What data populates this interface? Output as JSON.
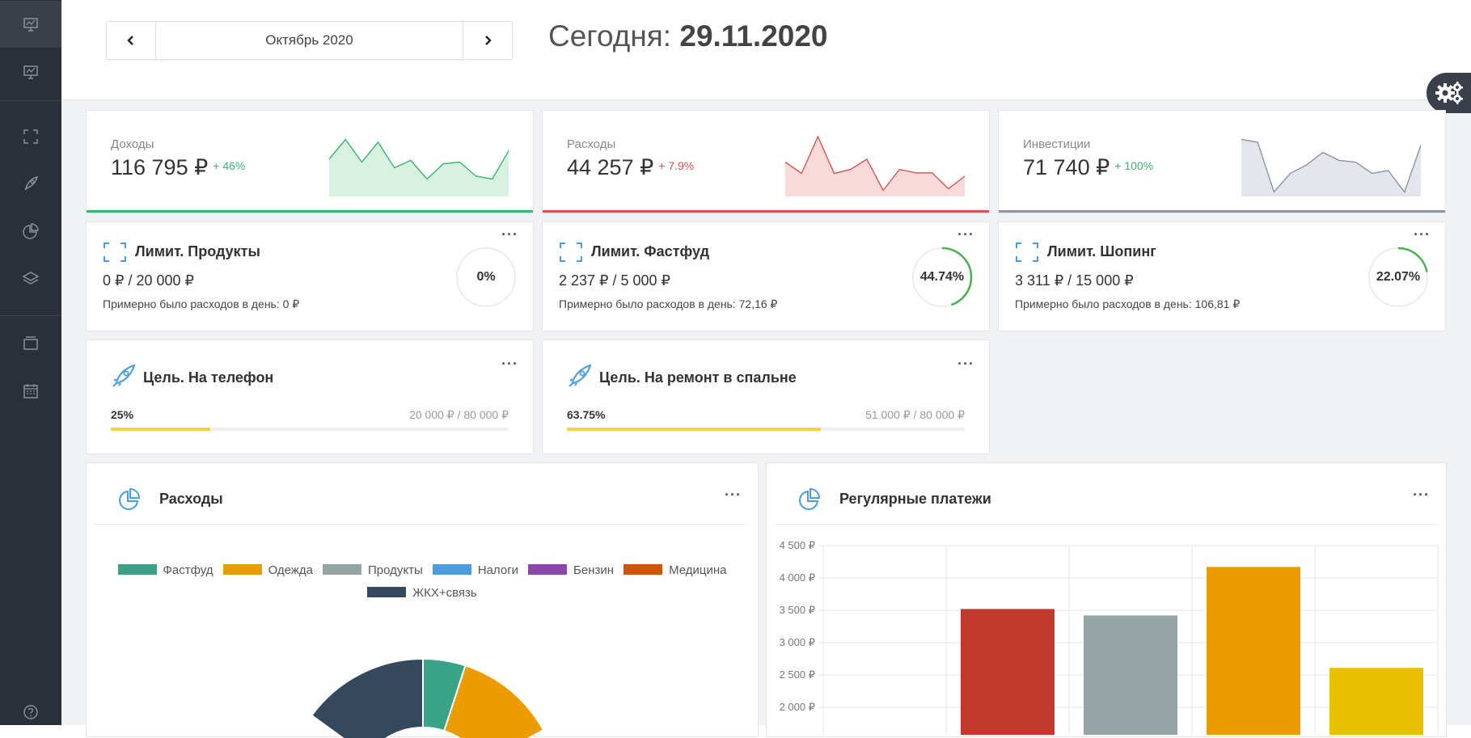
{
  "sidebar": {
    "items": [
      {
        "icon": "monitor-chart-icon",
        "active": true
      },
      {
        "icon": "monitor-chart-icon",
        "active": false
      },
      {
        "icon": "frame-icon",
        "active": false
      },
      {
        "icon": "rocket-icon",
        "active": false
      },
      {
        "icon": "pie-chart-icon",
        "active": false
      },
      {
        "icon": "layers-icon",
        "active": false
      },
      {
        "icon": "folder-icon",
        "active": false
      },
      {
        "icon": "calendar-icon",
        "active": false
      },
      {
        "icon": "help-icon",
        "active": false
      }
    ]
  },
  "header": {
    "month": "Октябрь 2020",
    "today_label": "Сегодня:",
    "today_date": "29.11.2020",
    "prev_icon": "chevron-left-icon",
    "next_icon": "chevron-right-icon",
    "settings_icon": "gears-icon"
  },
  "stats": [
    {
      "title": "Доходы",
      "value": "116 795 ₽",
      "delta": "+ 46%",
      "color": "#3cb371",
      "delta_color": "#3cb371",
      "fill": "#d8f2e1",
      "spark": [
        0.6,
        0.95,
        0.55,
        0.9,
        0.45,
        0.58,
        0.25,
        0.52,
        0.55,
        0.3,
        0.25,
        0.75
      ]
    },
    {
      "title": "Расходы",
      "value": "44 257 ₽",
      "delta": "+ 7.9%",
      "color": "#d9534f",
      "delta_color": "#d9534f",
      "fill": "#f8dadb",
      "spark": [
        0.55,
        0.35,
        1.0,
        0.35,
        0.42,
        0.6,
        0.05,
        0.42,
        0.36,
        0.36,
        0.08,
        0.3
      ]
    },
    {
      "title": "Инвестиции",
      "value": "71 740 ₽",
      "delta": "+ 100%",
      "color": "#8a95a8",
      "delta_color": "#3cb371",
      "fill": "#e3e6eb",
      "spark": [
        0.95,
        0.9,
        0.02,
        0.35,
        0.5,
        0.72,
        0.58,
        0.55,
        0.35,
        0.4,
        0.02,
        0.85
      ]
    }
  ],
  "limits": [
    {
      "title": "Лимит. Продукты",
      "amount": "0 ₽ / 20 000 ₽",
      "note": "Примерно было расходов в день: 0 ₽",
      "percent_label": "0%",
      "progress": 0.0
    },
    {
      "title": "Лимит. Фастфуд",
      "amount": "2 237 ₽ / 5 000 ₽",
      "note": "Примерно было расходов в день: 72,16 ₽",
      "percent_label": "44.74%",
      "progress": 0.4474
    },
    {
      "title": "Лимит. Шопинг",
      "amount": "3 311 ₽ / 15 000 ₽",
      "note": "Примерно было расходов в день: 106,81 ₽",
      "percent_label": "22.07%",
      "progress": 0.2207
    }
  ],
  "goals": [
    {
      "title": "Цель. На телефон",
      "percent_label": "25%",
      "amount": "20 000 ₽ / 80 000 ₽",
      "progress": 0.25
    },
    {
      "title": "Цель. На ремонт в спальне",
      "percent_label": "63.75%",
      "amount": "51 000 ₽ / 80 000 ₽",
      "progress": 0.6375
    }
  ],
  "panels": {
    "expenses_title": "Расходы",
    "regular_title": "Регулярные платежи",
    "more_label": "···"
  },
  "chart_data": [
    {
      "type": "pie",
      "title": "",
      "legend": [
        "Фастфуд",
        "Одежда",
        "Продукты",
        "Налоги",
        "Бензин",
        "Медицина",
        "ЖКХ+связь"
      ],
      "colors": [
        "#3aa287",
        "#eb9c00",
        "#95a5a6",
        "#4a9ee0",
        "#8e44ad",
        "#d35400",
        "#34495e"
      ],
      "visible_slices": [
        {
          "label": "Фастфуд",
          "share": 0.05
        },
        {
          "label": "Одежда",
          "share": 0.12
        },
        {
          "label": "ЖКХ+связь",
          "share": 0.15
        }
      ]
    },
    {
      "type": "bar",
      "title": "",
      "categories": [
        "",
        "",
        "",
        "",
        ""
      ],
      "values": [
        0,
        3520,
        3420,
        4170,
        2610
      ],
      "colors": [
        "#ffffff",
        "#c0392b",
        "#95a5a6",
        "#eb9c00",
        "#e8c100"
      ],
      "y_ticks": [
        "4 500 ₽",
        "4 000 ₽",
        "3 500 ₽",
        "3 000 ₽",
        "2 500 ₽",
        "2 000 ₽"
      ],
      "ylim": [
        2000,
        4500
      ],
      "grid": true
    }
  ]
}
